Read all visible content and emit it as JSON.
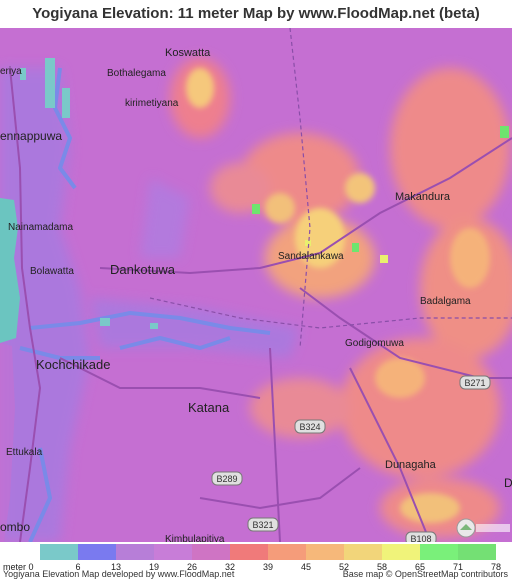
{
  "title": "Yogiyana Elevation: 11 meter Map by www.FloodMap.net (beta)",
  "places": [
    {
      "id": "koswatta",
      "name": "Koswatta",
      "size": 11
    },
    {
      "id": "eriya",
      "name": "eriya",
      "size": 10
    },
    {
      "id": "bothalegama",
      "name": "Bothalegama",
      "size": 10
    },
    {
      "id": "kirimetiyana",
      "name": "kirimetiyana",
      "size": 10
    },
    {
      "id": "ennappuwa",
      "name": "ennappuwa",
      "size": 12
    },
    {
      "id": "makandura",
      "name": "Makandura",
      "size": 11
    },
    {
      "id": "nainamadama",
      "name": "Nainamadama",
      "size": 10
    },
    {
      "id": "sandalankawa",
      "name": "Sandalankawa",
      "size": 10
    },
    {
      "id": "dankotuwa",
      "name": "Dankotuwa",
      "size": 13
    },
    {
      "id": "bolawatta",
      "name": "Bolawatta",
      "size": 10
    },
    {
      "id": "badalgama",
      "name": "Badalgama",
      "size": 10
    },
    {
      "id": "godigomuwa",
      "name": "Godigomuwa",
      "size": 10
    },
    {
      "id": "kochchikade",
      "name": "Kochchikade",
      "size": 13
    },
    {
      "id": "katana",
      "name": "Katana",
      "size": 13
    },
    {
      "id": "ettukala",
      "name": "Ettukala",
      "size": 10
    },
    {
      "id": "dunagaha",
      "name": "Dunagaha",
      "size": 11
    },
    {
      "id": "ombo",
      "name": "ombo",
      "size": 12
    },
    {
      "id": "kimbulapitiya",
      "name": "Kimbulapitiya",
      "size": 10
    },
    {
      "id": "d-edge",
      "name": "D",
      "size": 12
    }
  ],
  "road_shields": [
    "B271",
    "B324",
    "B289",
    "B321",
    "B108"
  ],
  "legend": {
    "unit_label": "meter",
    "start_label": "0",
    "bins": [
      {
        "color": "#7ac9c9",
        "label": "6"
      },
      {
        "color": "#7a7aef",
        "label": "13"
      },
      {
        "color": "#b77ed8",
        "label": "19"
      },
      {
        "color": "#c87dd8",
        "label": "26"
      },
      {
        "color": "#cf74c4",
        "label": "32"
      },
      {
        "color": "#f07a7a",
        "label": "39"
      },
      {
        "color": "#f59c7a",
        "label": "45"
      },
      {
        "color": "#f6b87a",
        "label": "52"
      },
      {
        "color": "#f2d57a",
        "label": "58"
      },
      {
        "color": "#f0f37a",
        "label": "65"
      },
      {
        "color": "#7af07a",
        "label": "71"
      },
      {
        "color": "#74e074",
        "label": "78"
      }
    ]
  },
  "footer": {
    "left": "Yogiyana Elevation Map developed by www.FloodMap.net",
    "right": "Base map © OpenStreetMap contributors"
  },
  "colors": {
    "sea": "#6bc5c0",
    "base": "#c56fd2"
  }
}
